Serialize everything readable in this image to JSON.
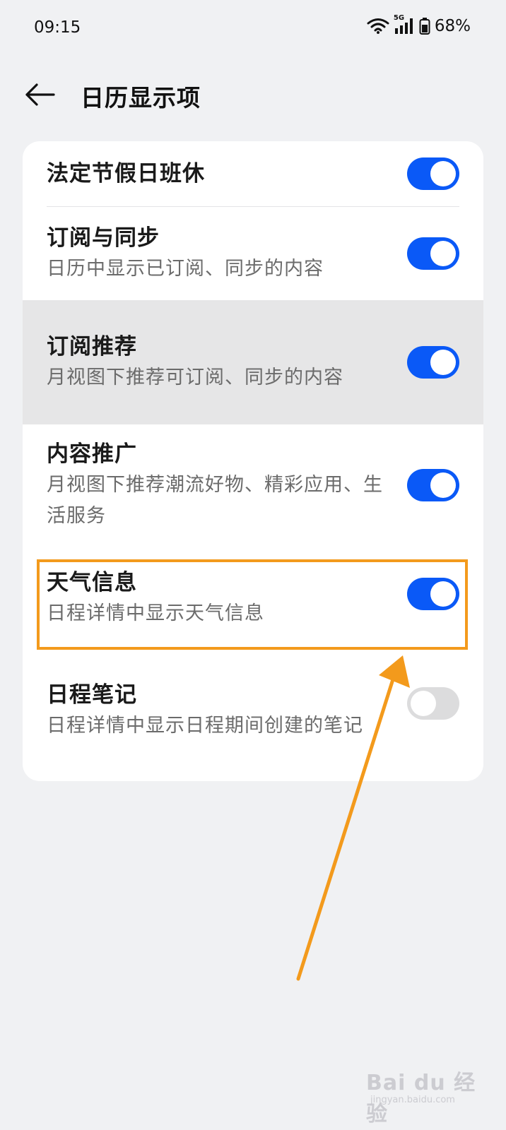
{
  "status_bar": {
    "time": "09:15",
    "network_label": "5G",
    "battery_percent": "68%"
  },
  "header": {
    "back_icon": "arrow-left-icon",
    "title": "日历显示项"
  },
  "settings": [
    {
      "title": "法定节假日班休",
      "subtitle": "",
      "enabled": true
    },
    {
      "title": "订阅与同步",
      "subtitle": "日历中显示已订阅、同步的内容",
      "enabled": true
    },
    {
      "title": "订阅推荐",
      "subtitle": "月视图下推荐可订阅、同步的内容",
      "enabled": true
    },
    {
      "title": "内容推广",
      "subtitle": "月视图下推荐潮流好物、精彩应用、生活服务",
      "enabled": true
    },
    {
      "title": "天气信息",
      "subtitle": "日程详情中显示天气信息",
      "enabled": true
    },
    {
      "title": "日程笔记",
      "subtitle": "日程详情中显示日程期间创建的笔记",
      "enabled": false
    }
  ],
  "colors": {
    "toggle_on": "#0a59f7",
    "toggle_off": "#dcdcdd",
    "annotation": "#f39a1c"
  },
  "watermark": {
    "brand": "Bai du 经验",
    "site": "jingyan.baidu.com"
  }
}
